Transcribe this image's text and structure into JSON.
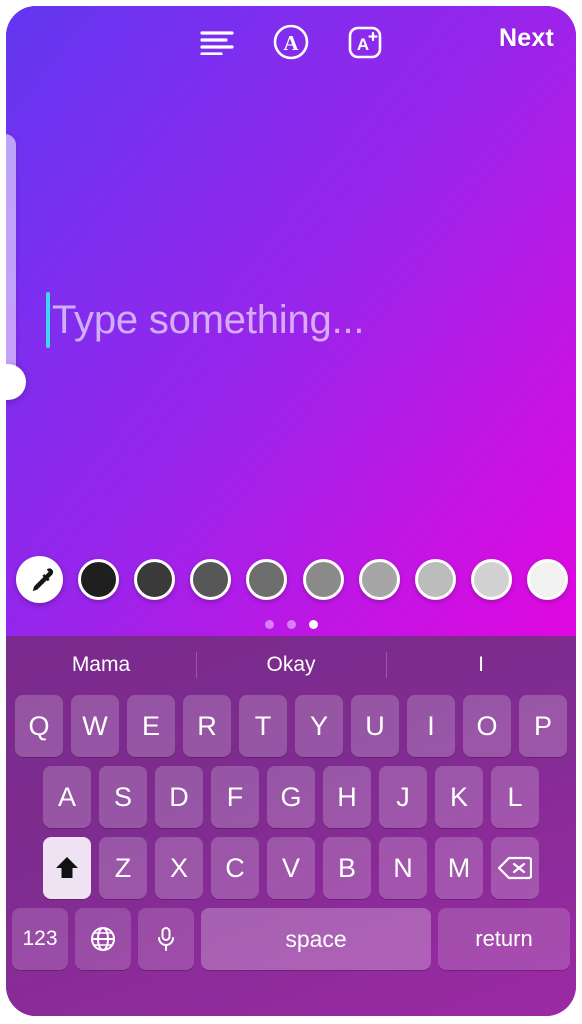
{
  "app": {
    "screen_name": "story-text-editor"
  },
  "topbar": {
    "next_label": "Next",
    "icons": [
      {
        "name": "text-align-left-icon",
        "label": "align"
      },
      {
        "name": "text-style-circle-a-icon",
        "label": "A"
      },
      {
        "name": "text-effects-a-plus-icon",
        "label": "A+"
      }
    ]
  },
  "text_editor": {
    "placeholder": "Type something...",
    "value": "",
    "caret_color": "#3fd8f5",
    "placeholder_color": "rgba(255,255,255,0.62)"
  },
  "background": {
    "gradient_from": "#6137ef",
    "gradient_to": "#e008e0",
    "gradient_angle_deg": 128
  },
  "size_slider": {
    "name": "font-size-slider",
    "value_position_pct": 90
  },
  "palette": {
    "eyedropper_label": "eyedropper",
    "swatches": [
      "#1f1f1f",
      "#3a3a3a",
      "#575757",
      "#6e6e6e",
      "#8a8a8a",
      "#a6a6a6",
      "#bcbcbc",
      "#d2d2d2",
      "#f1f1f1"
    ],
    "page_dots": {
      "count": 3,
      "active_index": 2
    }
  },
  "keyboard": {
    "suggestions": [
      "Mama",
      "Okay",
      "I"
    ],
    "row1": [
      "Q",
      "W",
      "E",
      "R",
      "T",
      "Y",
      "U",
      "I",
      "O",
      "P"
    ],
    "row2": [
      "A",
      "S",
      "D",
      "F",
      "G",
      "H",
      "J",
      "K",
      "L"
    ],
    "row3": [
      "Z",
      "X",
      "C",
      "V",
      "B",
      "N",
      "M"
    ],
    "shift_label": "shift",
    "shift_active": true,
    "backspace_label": "delete",
    "numbers_label": "123",
    "globe_label": "globe",
    "mic_label": "dictate",
    "space_label": "space",
    "return_label": "return"
  }
}
